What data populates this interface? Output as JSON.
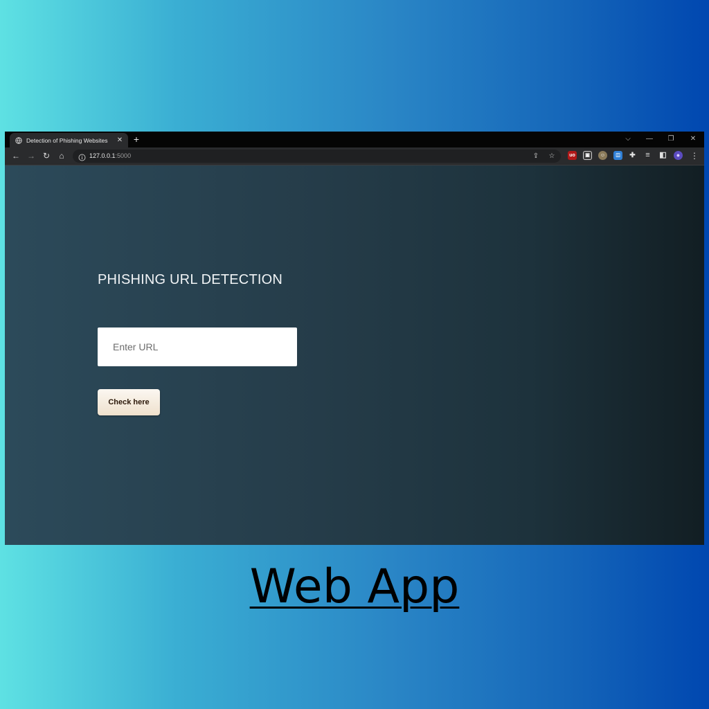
{
  "browser": {
    "tab": {
      "title": "Detection of Phishing Websites",
      "close_symbol": "✕",
      "favicon": "globe-icon"
    },
    "new_tab_symbol": "+",
    "window_controls": {
      "dropdown": "⌵",
      "minimize": "—",
      "restore": "❐",
      "close": "✕"
    },
    "nav": {
      "back": "←",
      "forward": "→",
      "reload": "↻",
      "home": "⌂"
    },
    "address": {
      "host": "127.0.0.1",
      "port": ":5000",
      "info_icon": "info-icon"
    },
    "omnibox_icons": {
      "share": "⇪",
      "bookmark": "☆"
    },
    "extensions": [
      {
        "name": "ublock-icon",
        "glyph": "uo",
        "color": "#b01818"
      },
      {
        "name": "screen-capture-icon",
        "glyph": "▣",
        "color": "#3a3a3a"
      },
      {
        "name": "face-extension-icon",
        "glyph": "☺",
        "color": "#8a7a5a"
      },
      {
        "name": "translate-icon",
        "glyph": "◫",
        "color": "#2f7fd6"
      },
      {
        "name": "extensions-puzzle-icon",
        "glyph": "✚",
        "color": "#2a2b2d"
      },
      {
        "name": "reading-list-icon",
        "glyph": "≡",
        "color": "#2a2b2d"
      },
      {
        "name": "side-panel-icon",
        "glyph": "◧",
        "color": "#2a2b2d"
      },
      {
        "name": "profile-avatar-icon",
        "glyph": "●",
        "color": "#5b4bbf"
      }
    ],
    "menu_symbol": "⋮"
  },
  "page": {
    "title": "PHISHING URL DETECTION",
    "url_input": {
      "placeholder": "Enter URL",
      "value": ""
    },
    "submit_label": "Check here",
    "colors": {
      "button_text": "#2b1708",
      "title": "#f1f4f6"
    }
  },
  "caption": "Web App"
}
